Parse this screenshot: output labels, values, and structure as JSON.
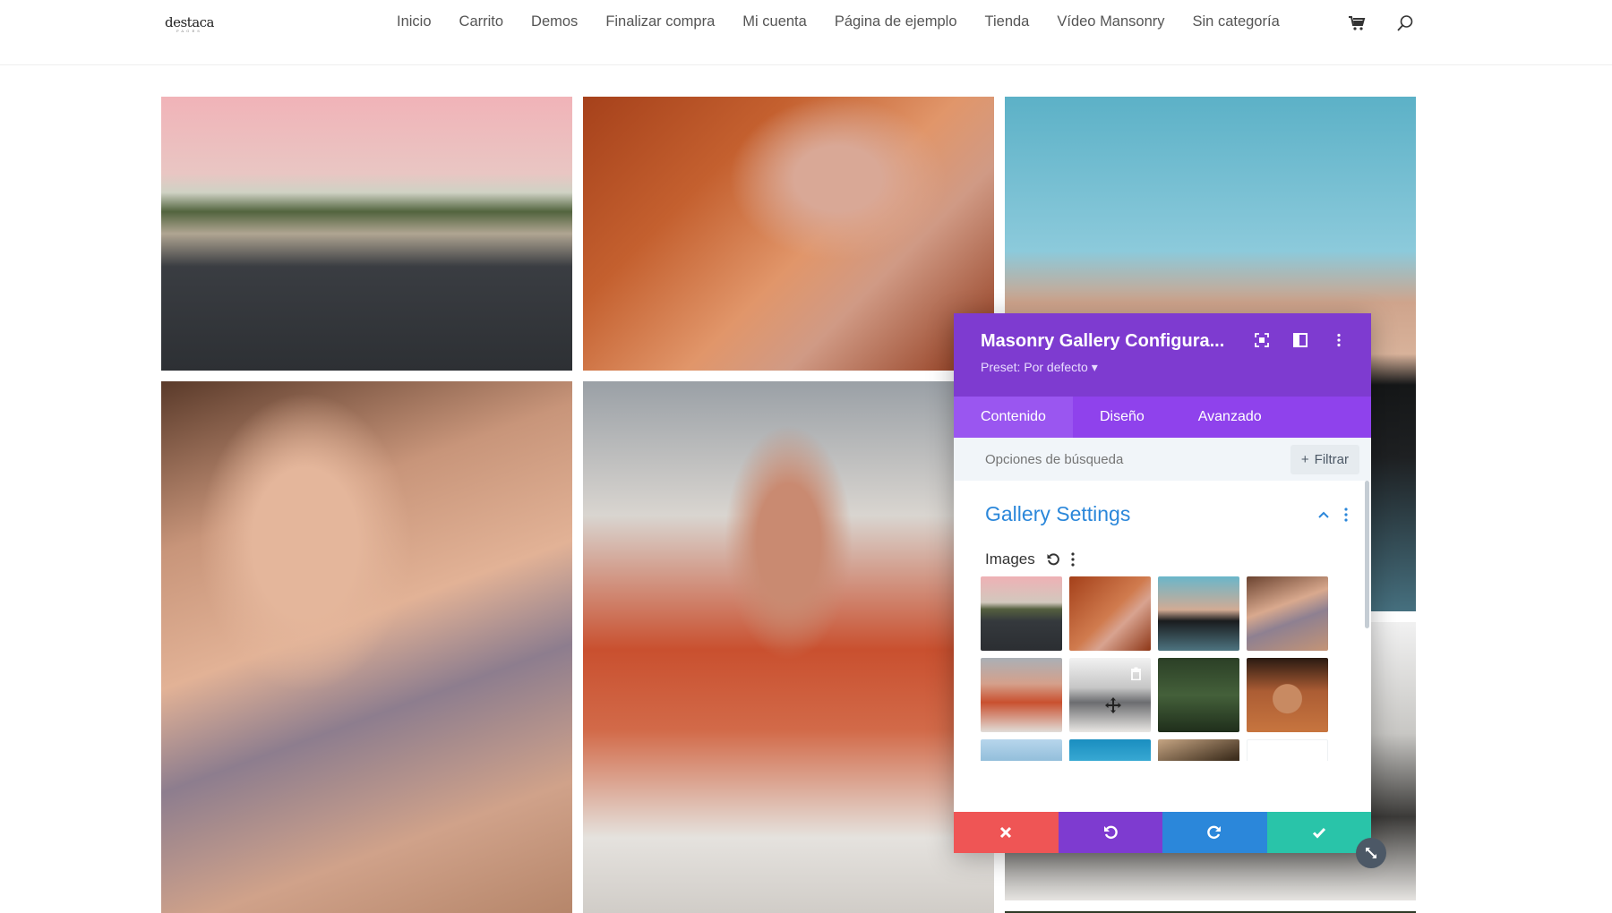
{
  "header": {
    "logo_text": "destaca",
    "logo_sub": "PAGES",
    "nav": [
      "Inicio",
      "Carrito",
      "Demos",
      "Finalizar compra",
      "Mi cuenta",
      "Página de ejemplo",
      "Tienda",
      "Vídeo Mansonry",
      "Sin categoría"
    ],
    "icons": [
      "cart-icon",
      "search-icon"
    ]
  },
  "gallery": {
    "tiles": [
      "man-walking-road",
      "red-hair-woman",
      "man-blue-cap",
      "woman-long-hair",
      "woman-sunglasses",
      "man-white-shirt",
      "forest"
    ]
  },
  "panel": {
    "title": "Masonry Gallery Configura...",
    "preset": "Preset: Por defecto",
    "tabs": [
      "Contenido",
      "Diseño",
      "Avanzado"
    ],
    "active_tab": "Contenido",
    "search_placeholder": "Opciones de búsqueda",
    "filter_label": "Filtrar",
    "section_title": "Gallery Settings",
    "images_label": "Images",
    "colors": {
      "header": "#7e3bd0",
      "tabs": "#8f42ec",
      "section": "#2b87da",
      "cancel": "#ef5555",
      "undo": "#7e3bd0",
      "redo": "#2b87da",
      "save": "#29c4a9"
    }
  }
}
